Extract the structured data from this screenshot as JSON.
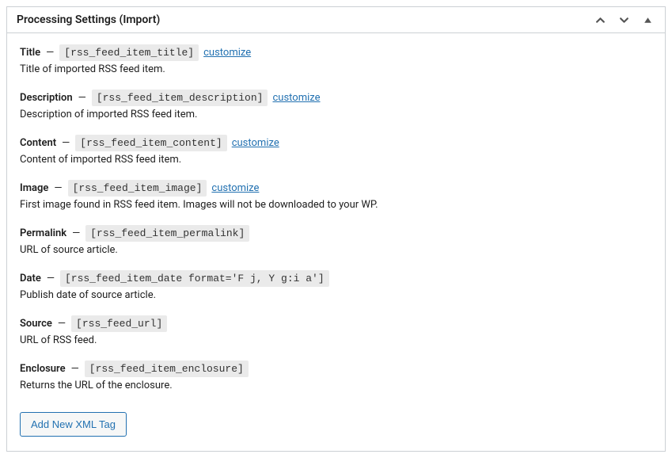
{
  "panel": {
    "title": "Processing Settings (Import)"
  },
  "fields": [
    {
      "label": "Title",
      "token": "[rss_feed_item_title]",
      "customize": "customize",
      "desc": "Title of imported RSS feed item."
    },
    {
      "label": "Description",
      "token": "[rss_feed_item_description]",
      "customize": "customize",
      "desc": "Description of imported RSS feed item."
    },
    {
      "label": "Content",
      "token": "[rss_feed_item_content]",
      "customize": "customize",
      "desc": "Content of imported RSS feed item."
    },
    {
      "label": "Image",
      "token": "[rss_feed_item_image]",
      "customize": "customize",
      "desc": "First image found in RSS feed item. Images will not be downloaded to your WP."
    },
    {
      "label": "Permalink",
      "token": "[rss_feed_item_permalink]",
      "customize": null,
      "desc": "URL of source article."
    },
    {
      "label": "Date",
      "token": "[rss_feed_item_date format='F j, Y g:i a']",
      "customize": null,
      "desc": "Publish date of source article."
    },
    {
      "label": "Source",
      "token": "[rss_feed_url]",
      "customize": null,
      "desc": "URL of RSS feed."
    },
    {
      "label": "Enclosure",
      "token": "[rss_feed_item_enclosure]",
      "customize": null,
      "desc": "Returns the URL of the enclosure."
    }
  ],
  "buttons": {
    "add_tag": "Add New XML Tag"
  }
}
